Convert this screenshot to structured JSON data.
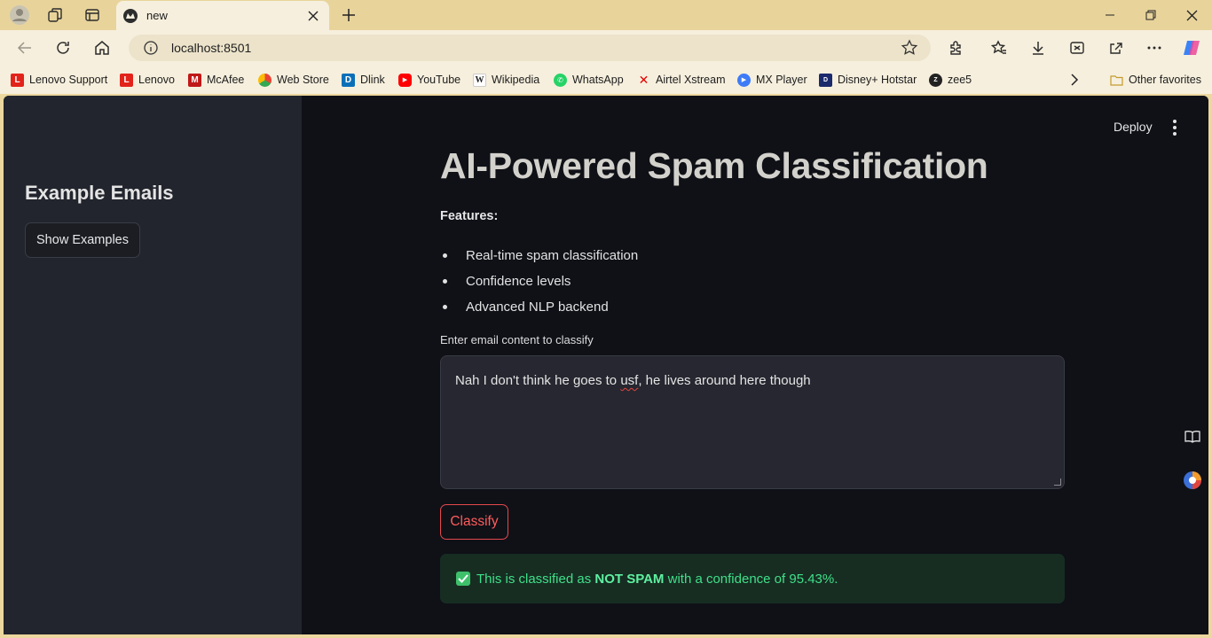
{
  "browser": {
    "tab_title": "new",
    "url": "localhost:8501",
    "bookmarks": [
      {
        "label": "Lenovo Support",
        "icon": "lenovo-icon",
        "color": "#e2231a"
      },
      {
        "label": "Lenovo",
        "icon": "lenovo-icon",
        "color": "#e2231a"
      },
      {
        "label": "McAfee",
        "icon": "mcafee-icon",
        "color": "#c01818"
      },
      {
        "label": "Web Store",
        "icon": "webstore-icon",
        "color": "#4285f4"
      },
      {
        "label": "Dlink",
        "icon": "dlink-icon",
        "color": "#0b6fb8"
      },
      {
        "label": "YouTube",
        "icon": "youtube-icon",
        "color": "#ff0000"
      },
      {
        "label": "Wikipedia",
        "icon": "wikipedia-icon",
        "color": "#ffffff"
      },
      {
        "label": "WhatsApp",
        "icon": "whatsapp-icon",
        "color": "#25d366"
      },
      {
        "label": "Airtel Xstream",
        "icon": "airtel-icon",
        "color": "#e40000"
      },
      {
        "label": "MX Player",
        "icon": "mxplayer-icon",
        "color": "#3e7bf6"
      },
      {
        "label": "Disney+ Hotstar",
        "icon": "hotstar-icon",
        "color": "#1a2a6c"
      },
      {
        "label": "zee5",
        "icon": "zee5-icon",
        "color": "#222222"
      }
    ],
    "other_favorites": "Other favorites"
  },
  "sidebar": {
    "title": "Example Emails",
    "show_examples_label": "Show Examples"
  },
  "header": {
    "deploy_label": "Deploy"
  },
  "main": {
    "title": "AI-Powered Spam Classification",
    "features_label": "Features:",
    "features": [
      "Real-time spam classification",
      "Confidence levels",
      "Advanced NLP backend"
    ],
    "input_label": "Enter email content to classify",
    "input_before": "Nah I don't think he goes to ",
    "input_misspelled": "usf",
    "input_after": ", he lives around here though",
    "classify_label": "Classify",
    "result": {
      "prefix": "This is classified as ",
      "label": "NOT SPAM",
      "suffix": " with a confidence of 95.43%."
    }
  },
  "colors": {
    "accent": "#ff4b4b",
    "success": "#3fe089",
    "background": "#0f1117",
    "sidebar": "#22252d"
  }
}
